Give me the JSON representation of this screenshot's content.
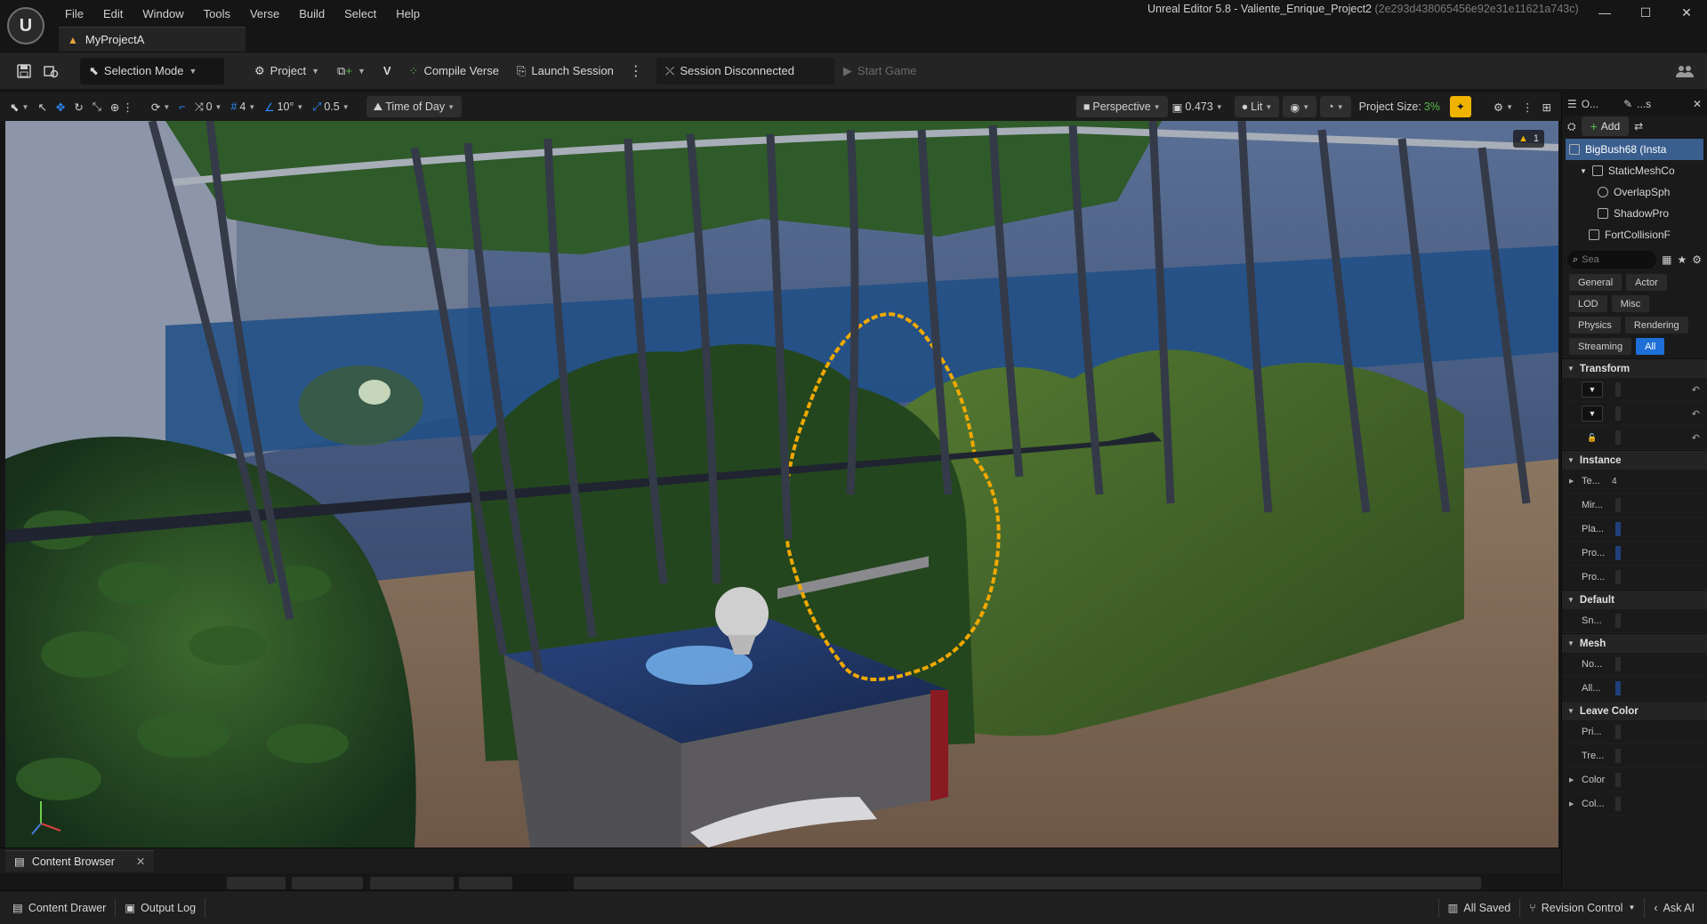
{
  "app": {
    "window_title": "Unreal Editor 5.8 - Valiente_Enrique_Project2",
    "window_hash": "(2e293d438065456e92e31e11621a743c)",
    "project_tab": "MyProjectA",
    "logo_text": "U"
  },
  "menu": [
    "File",
    "Edit",
    "Window",
    "Tools",
    "Verse",
    "Build",
    "Select",
    "Help"
  ],
  "window_controls": {
    "minimize": "—",
    "maximize": "☐",
    "close": "✕"
  },
  "toolbar": {
    "selection_mode": "Selection Mode",
    "project": "Project",
    "compile_verse": "Compile Verse",
    "launch_session": "Launch Session",
    "session_status": "Session Disconnected",
    "start_game": "Start Game"
  },
  "viewport_toolbar": {
    "rotation_snap": "0",
    "grid_size": "4",
    "angle_snap": "10°",
    "scale_snap": "0.5",
    "time_of_day": "Time of Day",
    "perspective": "Perspective",
    "camera_speed": "0.473",
    "lit": "Lit",
    "project_size_label": "Project Size:",
    "project_size_value": "3%"
  },
  "viewport": {
    "warning_count": "1"
  },
  "right_panel": {
    "tab_outliner": "O...",
    "tab_details": "...s",
    "add_label": "Add",
    "tree": [
      {
        "label": "BigBush68 (Insta",
        "indent": 0,
        "selected": true
      },
      {
        "label": "StaticMeshCo",
        "indent": 1,
        "selected": false
      },
      {
        "label": "OverlapSph",
        "indent": 2,
        "selected": false
      },
      {
        "label": "ShadowPro",
        "indent": 2,
        "selected": false
      },
      {
        "label": "FortCollisionF",
        "indent": 1,
        "selected": false
      }
    ],
    "search_placeholder": "Sea",
    "filters": [
      "General",
      "Actor",
      "LOD",
      "Misc",
      "Physics",
      "Rendering",
      "Streaming",
      "All"
    ],
    "active_filter": "All",
    "sections": [
      {
        "title": "Transform",
        "rows": [
          {
            "type": "dropdown",
            "label": ""
          },
          {
            "type": "dropdown",
            "label": ""
          },
          {
            "type": "lock",
            "label": ""
          }
        ]
      },
      {
        "title": "Instance",
        "rows": [
          {
            "type": "expandable",
            "label": "Te...",
            "value": "4"
          },
          {
            "type": "plain",
            "label": "Mir..."
          },
          {
            "type": "plain",
            "label": "Pla..."
          },
          {
            "type": "plain",
            "label": "Pro..."
          },
          {
            "type": "plain",
            "label": "Pro..."
          }
        ]
      },
      {
        "title": "Default",
        "rows": [
          {
            "type": "plain",
            "label": "Sn..."
          }
        ]
      },
      {
        "title": "Mesh",
        "rows": [
          {
            "type": "plain",
            "label": "No..."
          },
          {
            "type": "plain",
            "label": "All..."
          }
        ]
      },
      {
        "title": "Leave Color",
        "rows": [
          {
            "type": "plain",
            "label": "Pri..."
          },
          {
            "type": "plain",
            "label": "Tre..."
          },
          {
            "type": "expandable",
            "label": "Color"
          },
          {
            "type": "expandable",
            "label": "Col..."
          }
        ]
      }
    ]
  },
  "content_browser": {
    "tab_label": "Content Browser",
    "close": "✕"
  },
  "statusbar": {
    "content_drawer": "Content Drawer",
    "output_log": "Output Log",
    "all_saved": "All Saved",
    "revision_control": "Revision Control",
    "ask_ai": "Ask AI"
  },
  "colors": {
    "accent_blue": "#1e6fd8",
    "selection_blue": "#3a5f8f",
    "highlight_orange": "#f0a800",
    "success_green": "#58b94c",
    "warning_yellow": "#f0b400"
  }
}
